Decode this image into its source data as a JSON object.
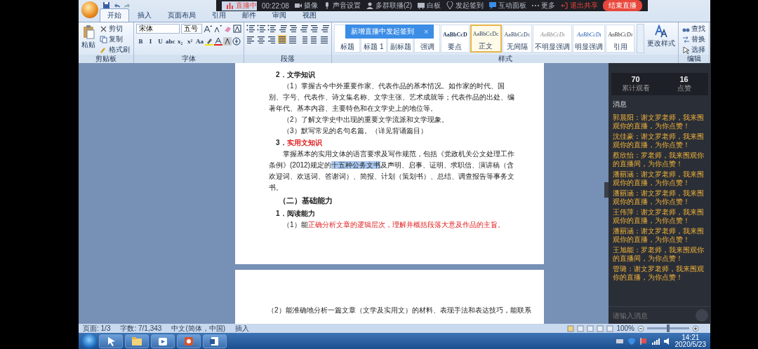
{
  "live_toolbar": {
    "items": [
      {
        "kind": "status",
        "label": "直播中"
      },
      {
        "kind": "timer",
        "label": "00:22:08"
      },
      {
        "kind": "camera",
        "label": "摄像"
      },
      {
        "kind": "mic",
        "label": "声音设置"
      },
      {
        "kind": "group",
        "label": "多群联播(2)"
      },
      {
        "kind": "board",
        "label": "白板"
      },
      {
        "kind": "signin",
        "label": "发起签到"
      },
      {
        "kind": "panel",
        "label": "互动面板"
      },
      {
        "kind": "more",
        "label": "更多"
      },
      {
        "kind": "exit",
        "label": "退出共享"
      },
      {
        "kind": "end",
        "label": "结束直播"
      }
    ]
  },
  "tip": {
    "text": "新增直播中发起签到",
    "close": "×"
  },
  "tabs": [
    {
      "label": "开始",
      "selected": true
    },
    {
      "label": "插入",
      "selected": false
    },
    {
      "label": "页面布局",
      "selected": false
    },
    {
      "label": "引用",
      "selected": false
    },
    {
      "label": "邮件",
      "selected": false
    },
    {
      "label": "审阅",
      "selected": false
    },
    {
      "label": "视图",
      "selected": false
    }
  ],
  "clipboard": {
    "paste": "粘贴",
    "items": [
      "剪切",
      "复制",
      "格式刷"
    ],
    "label": "剪贴板"
  },
  "font": {
    "name": "宋体",
    "size": "五号",
    "glyphs": [
      "B",
      "I",
      "U",
      "abc",
      "x₂",
      "x²",
      "Aa"
    ],
    "label": "字体"
  },
  "paragraph": {
    "label": "段落"
  },
  "styles": {
    "label": "样式",
    "items": [
      {
        "label": "标题",
        "selected": false
      },
      {
        "label": "标题 1",
        "selected": false
      },
      {
        "label": "副标题",
        "selected": false
      },
      {
        "label": "强调",
        "selected": false
      },
      {
        "preview": "AaBbCcD",
        "kind": "bold",
        "label": "要点",
        "selected": false
      },
      {
        "preview": "AaBbCcDc",
        "kind": "plain",
        "label": "正文",
        "selected": true
      },
      {
        "preview": "AaBbCcDc",
        "kind": "plain",
        "label": "无间隔",
        "selected": false
      },
      {
        "preview": "AaBbCcDı",
        "kind": "subtle",
        "label": "不明显强调",
        "selected": false
      },
      {
        "preview": "AaBbCcDı",
        "kind": "intense",
        "label": "明显强调",
        "selected": false
      },
      {
        "preview": "AaBbCcDı",
        "kind": "quote",
        "label": "引用",
        "selected": false
      }
    ],
    "change": "更改样式"
  },
  "editing": {
    "items": [
      "查找",
      "替换",
      "选择"
    ],
    "label": "编辑"
  },
  "document": {
    "pages": [
      {
        "blocks": [
          {
            "kind": "item_title",
            "segments": [
              {
                "kind": "plain",
                "text": "2．文学知识"
              }
            ]
          },
          {
            "kind": "para",
            "segments": [
              {
                "kind": "plain",
                "text": "（1）掌握古今中外重要作家、代表作品的基本情况。如作家的时代、国别、字号、代表作、诗文集名称、文学主张、艺术成就等；代表作品的出处、编著年代、基本内容、主要特色和在文学史上的地位等。"
              }
            ]
          },
          {
            "kind": "para",
            "segments": [
              {
                "kind": "plain",
                "text": "（2）了解文学史中出现的重要文学流派和文学现象。"
              }
            ]
          },
          {
            "kind": "para",
            "segments": [
              {
                "kind": "plain",
                "text": "（3）默写常见的名句名篇。（详见背诵篇目）"
              }
            ]
          },
          {
            "kind": "item_title",
            "segments": [
              {
                "kind": "plain",
                "text": "3．"
              },
              {
                "kind": "red",
                "text": "实用文知识"
              }
            ]
          },
          {
            "kind": "para",
            "segments": [
              {
                "kind": "plain",
                "text": "掌握基本的实用文体的语言要求及写作规范，包括《党政机关公文处理工作条例》(2012)规定的"
              },
              {
                "kind": "selected",
                "text": "十五种公务文书"
              },
              {
                "kind": "plain",
                "text": "及声明、启事、证明、求职信、演讲稿（含欢迎词、欢送词、答谢词）、简报、计划（策划书）、总结、调查报告等事务文书。"
              }
            ]
          },
          {
            "kind": "section",
            "segments": [
              {
                "kind": "plain",
                "text": "（二）基础能力"
              }
            ]
          },
          {
            "kind": "item_title",
            "segments": [
              {
                "kind": "plain",
                "text": "1．阅读能力"
              }
            ]
          },
          {
            "kind": "para",
            "segments": [
              {
                "kind": "plain",
                "text": "（1）能"
              },
              {
                "kind": "red",
                "text": "正确分析文章的逻辑层次，理解并概括段落大意及作品的主旨。"
              }
            ]
          }
        ]
      },
      {
        "blocks": [
          {
            "kind": "para",
            "segments": [
              {
                "kind": "plain",
                "text": "（2）能准确地分析一篇文章（文学及实用文）的材料、表现手法和表达技巧，能联系"
              }
            ]
          }
        ]
      }
    ]
  },
  "live_panel": {
    "stats": [
      {
        "value": "70",
        "label": "累计观看"
      },
      {
        "value": "16",
        "label": "点赞"
      }
    ],
    "messages_title": "消息",
    "messages": [
      {
        "name": "郭晨阳：",
        "text": "谢文罗老师，我来围观你的直播，为你点赞！"
      },
      {
        "name": "沈佳豪：",
        "text": "谢文罗老师，我来围观你的直播，为你点赞！"
      },
      {
        "name": "蔡欣怡：",
        "text": "罗老师，我来围观你的直播间，为你点赞！"
      },
      {
        "name": "潘丽涵：",
        "text": "谢文罗老师，我来围观你的直播，为你点赞！"
      },
      {
        "name": "潘丽涵：",
        "text": "谢文罗老师，我来围观你的直播，为你点赞！"
      },
      {
        "name": "王伟萍：",
        "text": "谢文罗老师，我来围观你的直播，为你点赞！"
      },
      {
        "name": "潘丽涵：",
        "text": "谢文罗老师，我来围观你的直播，为你点赞！"
      },
      {
        "name": "王旭能：",
        "text": "罗老师，我来围观你的直播间，为你点赞！"
      },
      {
        "name": "管璐：",
        "text": "谢文罗老师，我来围观你的直播，为你点赞！"
      }
    ],
    "input": {
      "placeholder": "请输入消息"
    }
  },
  "status_bar": {
    "items": [
      "页面: 1/3",
      "字数: 7/1,343",
      "中文(简体，中国)",
      "插入"
    ],
    "zoom": "100%",
    "zoom_slider": {
      "level": 0.5
    }
  },
  "taskbar": {
    "apps": [
      {
        "kind": "pointer"
      },
      {
        "kind": "folder"
      },
      {
        "kind": "media"
      },
      {
        "kind": "slides"
      },
      {
        "kind": "word"
      }
    ],
    "time": "14:21",
    "date": "2020/5/23"
  }
}
